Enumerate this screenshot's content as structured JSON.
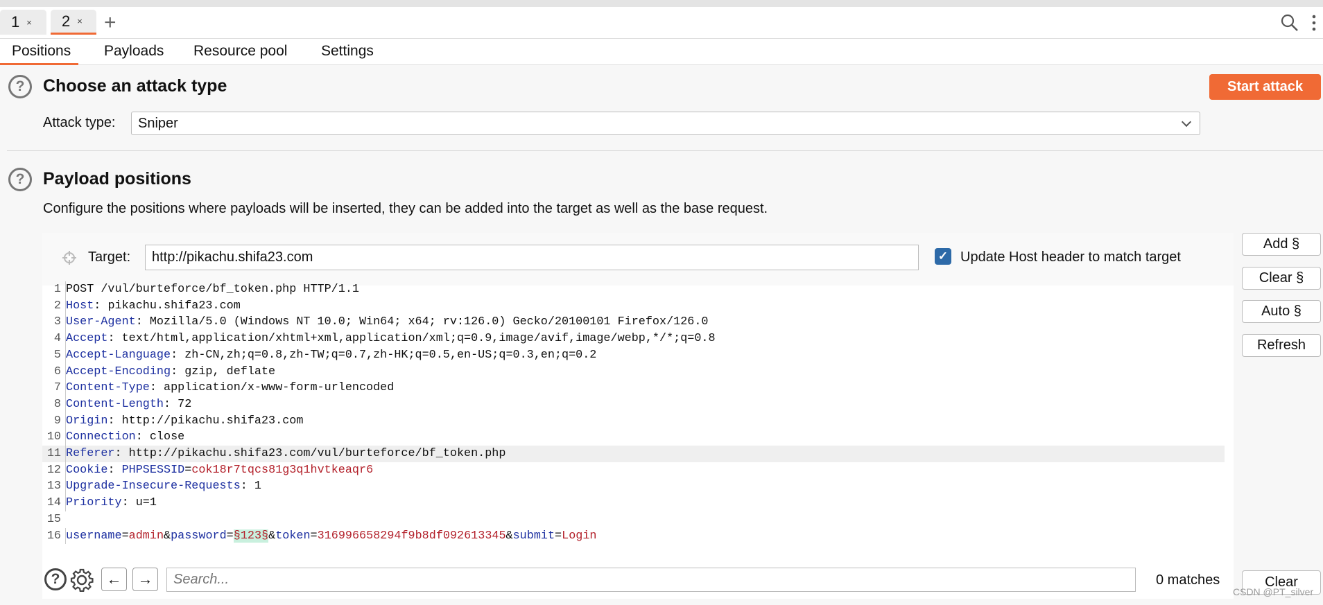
{
  "tabs": [
    {
      "label": "1",
      "close": "×"
    },
    {
      "label": "2",
      "close": "×"
    }
  ],
  "add_tab": "+",
  "subtabs": [
    "Positions",
    "Payloads",
    "Resource pool",
    "Settings"
  ],
  "attack": {
    "heading": "Choose an attack type",
    "start_button": "Start attack",
    "type_label": "Attack type:",
    "type_value": "Sniper"
  },
  "positions": {
    "heading": "Payload positions",
    "description": "Configure the positions where payloads will be inserted, they can be added into the target as well as the base request.",
    "target_label": "Target:",
    "target_value": "http://pikachu.shifa23.com",
    "update_host_label": "Update Host header to match target",
    "update_host_checked": true
  },
  "side_buttons": [
    "Add §",
    "Clear §",
    "Auto §",
    "Refresh"
  ],
  "request_lines": [
    [
      [
        "v",
        "POST /vul/burteforce/bf_token.php HTTP/1.1"
      ]
    ],
    [
      [
        "k",
        "Host"
      ],
      [
        "v",
        ": pikachu.shifa23.com"
      ]
    ],
    [
      [
        "k",
        "User-Agent"
      ],
      [
        "v",
        ": Mozilla/5.0 (Windows NT 10.0; Win64; x64; rv:126.0) Gecko/20100101 Firefox/126.0"
      ]
    ],
    [
      [
        "k",
        "Accept"
      ],
      [
        "v",
        ": text/html,application/xhtml+xml,application/xml;q=0.9,image/avif,image/webp,*/*;q=0.8"
      ]
    ],
    [
      [
        "k",
        "Accept-Language"
      ],
      [
        "v",
        ": zh-CN,zh;q=0.8,zh-TW;q=0.7,zh-HK;q=0.5,en-US;q=0.3,en;q=0.2"
      ]
    ],
    [
      [
        "k",
        "Accept-Encoding"
      ],
      [
        "v",
        ": gzip, deflate"
      ]
    ],
    [
      [
        "k",
        "Content-Type"
      ],
      [
        "v",
        ": application/x-www-form-urlencoded"
      ]
    ],
    [
      [
        "k",
        "Content-Length"
      ],
      [
        "v",
        ": 72"
      ]
    ],
    [
      [
        "k",
        "Origin"
      ],
      [
        "v",
        ": http://pikachu.shifa23.com"
      ]
    ],
    [
      [
        "k",
        "Connection"
      ],
      [
        "v",
        ": close"
      ]
    ],
    [
      [
        "k",
        "Referer"
      ],
      [
        "v",
        ": http://pikachu.shifa23.com/vul/burteforce/bf_token.php"
      ]
    ],
    [
      [
        "k",
        "Cookie"
      ],
      [
        "v",
        ": "
      ],
      [
        "k",
        "PHPSESSID"
      ],
      [
        "v",
        "="
      ],
      [
        "p",
        "cok18r7tqcs81g3q1hvtkeaqr6"
      ]
    ],
    [
      [
        "k",
        "Upgrade-Insecure-Requests"
      ],
      [
        "v",
        ": 1"
      ]
    ],
    [
      [
        "k",
        "Priority"
      ],
      [
        "v",
        ": u=1"
      ]
    ],
    [],
    [
      [
        "k",
        "username"
      ],
      [
        "v",
        "="
      ],
      [
        "p",
        "admin"
      ],
      [
        "v",
        "&"
      ],
      [
        "k",
        "password"
      ],
      [
        "v",
        "="
      ],
      [
        "sec",
        "§123§"
      ],
      [
        "v",
        "&"
      ],
      [
        "k",
        "token"
      ],
      [
        "v",
        "="
      ],
      [
        "p",
        "316996658294f9b8df092613345"
      ],
      [
        "v",
        "&"
      ],
      [
        "k",
        "submit"
      ],
      [
        "v",
        "="
      ],
      [
        "p",
        "Login"
      ]
    ]
  ],
  "highlighted_line": 11,
  "search": {
    "placeholder": "Search...",
    "matches": "0 matches",
    "clear": "Clear"
  },
  "watermark": "CSDN @PT_silver",
  "colors": {
    "accent": "#f06a35",
    "header_key": "#1c2fa0",
    "param_value": "#b3202a",
    "checkbox": "#2d6aa8",
    "payload_marker_bg": "#c9f0de"
  }
}
